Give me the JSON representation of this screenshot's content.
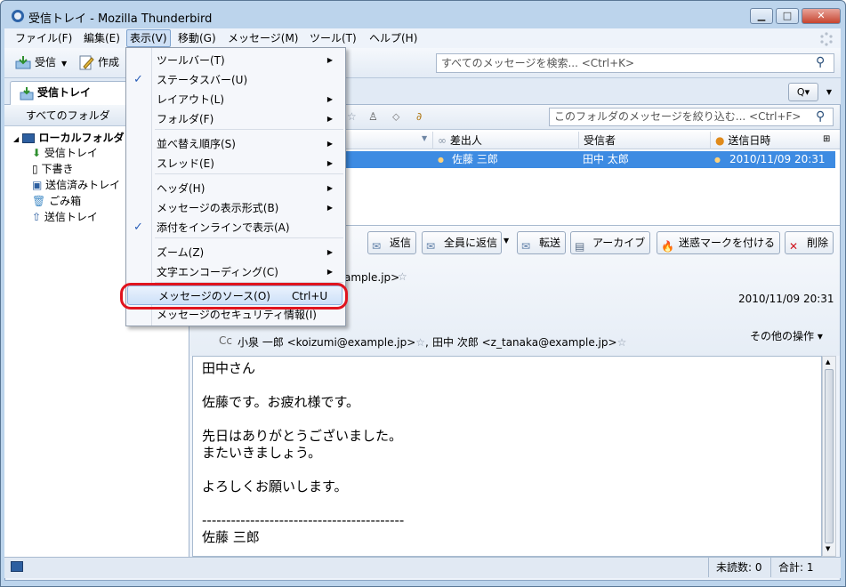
{
  "window": {
    "title": "受信トレイ - Mozilla Thunderbird",
    "minimize": "▁",
    "maximize": "□",
    "close": "✕"
  },
  "menubar": [
    "ファイル(F)",
    "編集(E)",
    "表示(V)",
    "移動(G)",
    "メッセージ(M)",
    "ツール(T)",
    "ヘルプ(H)"
  ],
  "toolbar": {
    "get_mail": "受信",
    "write": "作成",
    "search_placeholder": "すべてのメッセージを検索... <Ctrl+K>"
  },
  "tab": {
    "label": "受信トレイ"
  },
  "folder_pane": {
    "header": "すべてのフォルダ",
    "items": [
      "ローカルフォルダ",
      "受信トレイ",
      "下書き",
      "送信済みトレイ",
      "ごみ箱",
      "送信トレイ"
    ]
  },
  "filter": {
    "placeholder": "このフォルダのメッセージを絞り込む... <Ctrl+F>"
  },
  "columns": {
    "sender": "差出人",
    "recipient": "受信者",
    "date": "送信日時"
  },
  "message_row": {
    "sender": "佐藤 三郎",
    "recipient": "田中 太郎",
    "date": "2010/11/09 20:31"
  },
  "header_buttons": [
    "返信",
    "全員に返信",
    "転送",
    "アーカイブ",
    "迷惑マークを付ける",
    "削除"
  ],
  "headers": {
    "from_partial": "ample.jp>",
    "date": "2010/11/09 20:31",
    "cc_label": "Cc",
    "cc": "小泉 一郎 <koizumi@example.jp>",
    "cc2": "田中 次郎 <z_tanaka@example.jp>",
    "other_actions": "その他の操作"
  },
  "body_lines": [
    "田中さん",
    "",
    "佐藤です。お疲れ様です。",
    "",
    "先日はありがとうございました。",
    "またいきましょう。",
    "",
    "よろしくお願いします。",
    "",
    "------------------------------------------",
    "佐藤 三郎"
  ],
  "status": {
    "unread": "未読数: 0",
    "total": "合計: 1"
  },
  "view_menu": [
    {
      "label": "ツールバー(T)",
      "submenu": true
    },
    {
      "label": "ステータスバー(U)",
      "checked": true
    },
    {
      "label": "レイアウト(L)",
      "submenu": true
    },
    {
      "label": "フォルダ(F)",
      "submenu": true
    },
    {
      "label": "並べ替え順序(S)",
      "submenu": true
    },
    {
      "label": "スレッド(E)",
      "submenu": true
    },
    {
      "label": "ヘッダ(H)",
      "submenu": true
    },
    {
      "label": "メッセージの表示形式(B)",
      "submenu": true
    },
    {
      "label": "添付をインラインで表示(A)",
      "checked": true
    },
    {
      "label": "ズーム(Z)",
      "submenu": true
    },
    {
      "label": "文字エンコーディング(C)",
      "submenu": true
    },
    {
      "label": "メッセージのソース(O)",
      "shortcut": "Ctrl+U",
      "highlighted": true
    },
    {
      "label": "メッセージのセキュリティ情報(I)"
    }
  ]
}
